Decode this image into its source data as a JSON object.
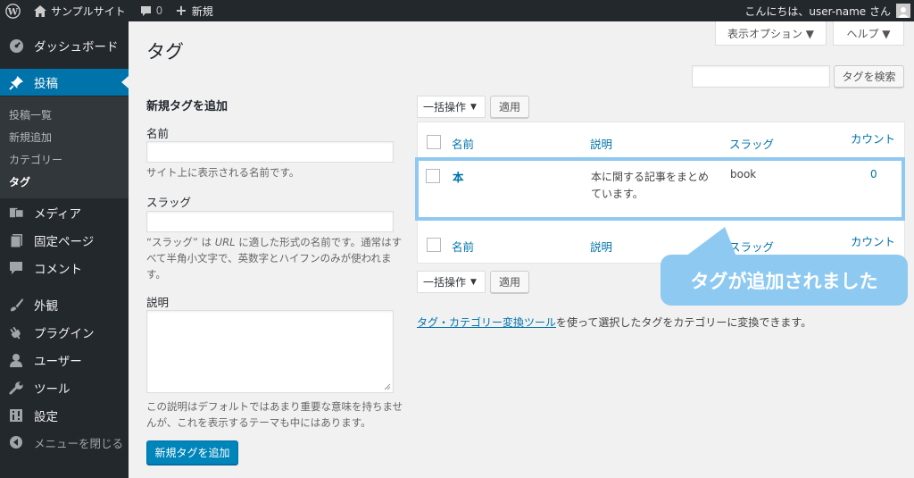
{
  "adminbar": {
    "site_name": "サンプルサイト",
    "comments_count": "0",
    "new_label": "新規",
    "greeting": "こんにちは、user-name さん"
  },
  "sidebar": {
    "items": [
      {
        "label": "ダッシュボード",
        "icon": "dashboard-icon"
      },
      {
        "label": "投稿",
        "icon": "pushpin-icon"
      },
      {
        "label": "メディア",
        "icon": "media-icon"
      },
      {
        "label": "固定ページ",
        "icon": "page-icon"
      },
      {
        "label": "コメント",
        "icon": "comment-icon"
      },
      {
        "label": "外観",
        "icon": "brush-icon"
      },
      {
        "label": "プラグイン",
        "icon": "plugin-icon"
      },
      {
        "label": "ユーザー",
        "icon": "user-icon"
      },
      {
        "label": "ツール",
        "icon": "wrench-icon"
      },
      {
        "label": "設定",
        "icon": "settings-icon"
      },
      {
        "label": "メニューを閉じる",
        "icon": "collapse-icon"
      }
    ],
    "submenu": [
      "投稿一覧",
      "新規追加",
      "カテゴリー",
      "タグ"
    ]
  },
  "page": {
    "title": "タグ",
    "screen_options": "表示オプション ▼",
    "help": "ヘルプ ▼",
    "search_button": "タグを検索"
  },
  "form": {
    "heading": "新規タグを追加",
    "name_label": "名前",
    "name_help": "サイト上に表示される名前です。",
    "slug_label": "スラッグ",
    "slug_help_1": "“スラッグ” は ",
    "slug_help_url": "URL",
    "slug_help_2": " に適した形式の名前です。通常はすべて半角小文字で、英数字とハイフンのみが使われます。",
    "desc_label": "説明",
    "desc_help": "この説明はデフォルトではあまり重要な意味を持ちませんが、これを表示するテーマも中にはあります。",
    "submit": "新規タグを追加"
  },
  "bulk": {
    "select": "一括操作",
    "apply": "適用"
  },
  "table": {
    "headers": {
      "name": "名前",
      "desc": "説明",
      "slug": "スラッグ",
      "count": "カウント"
    },
    "rows": [
      {
        "name": "本",
        "desc": "本に関する記事をまとめています。",
        "slug": "book",
        "count": "0"
      }
    ]
  },
  "callout": "タグが追加されました",
  "footer": {
    "link": "タグ・カテゴリー変換ツール",
    "text": "を使って選択したタグをカテゴリーに変換できます。"
  },
  "colors": {
    "accent": "#0073aa",
    "callout": "#8ec9f2",
    "sidebar_bg": "#23282d"
  }
}
